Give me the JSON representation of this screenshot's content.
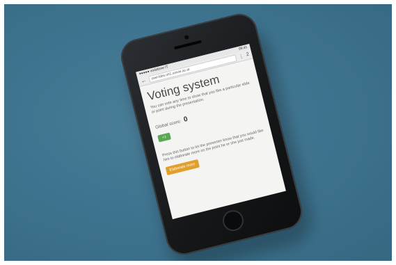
{
  "browser": {
    "status_left": "●●●●● vodafone IT",
    "status_time": "09:41",
    "url": "piwi-labs.nh1.univie.ac.at",
    "tab_count": "2"
  },
  "page": {
    "title": "Voting system",
    "description": "You can vote any time to show that you like a particular slide or point during the presentation.",
    "score_label": "Global score:",
    "score_value": "0",
    "plus_label": "+1",
    "explain_text": "Press this button to let the presenter know that you would like him to elaborate more on the point he or she just made.",
    "elaborate_label": "Elaborate more"
  },
  "colors": {
    "vote_button": "#5aa854",
    "elaborate_button": "#e1a02c",
    "background": "#3f7490"
  }
}
